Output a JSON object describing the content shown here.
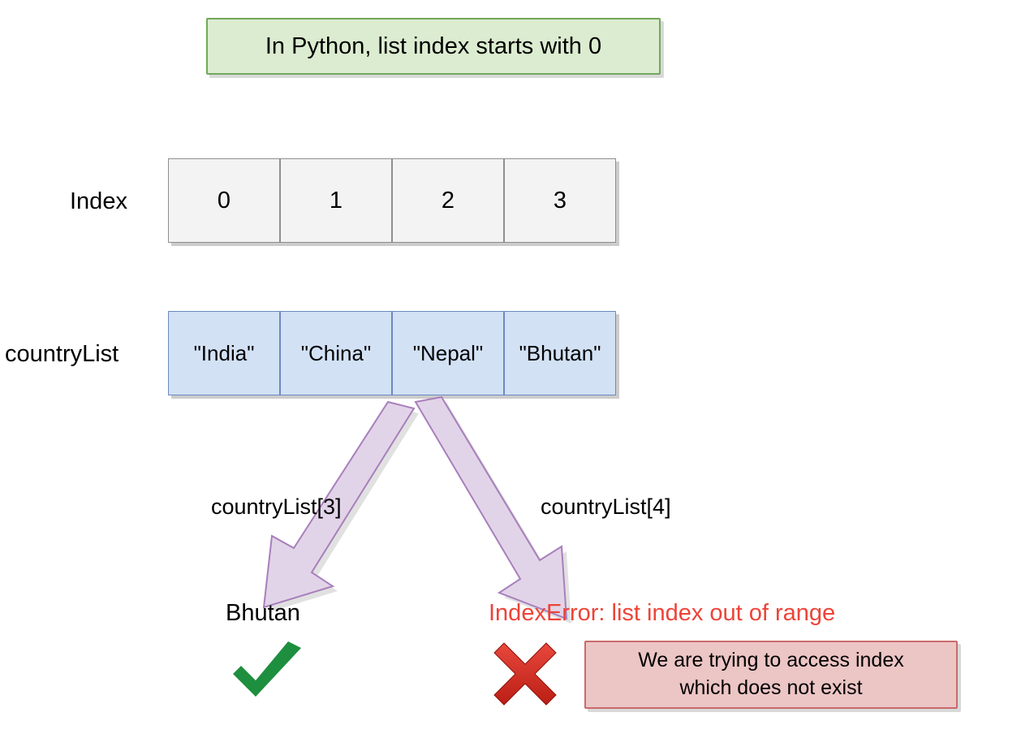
{
  "title": "In Python, list index starts with 0",
  "index_label": "Index",
  "list_label": "countryList",
  "indices": [
    "0",
    "1",
    "2",
    "3"
  ],
  "items": [
    "\"India\"",
    "\"China\"",
    "\"Nepal\"",
    "\"Bhutan\""
  ],
  "left_expr": "countryList[3]",
  "right_expr": "countryList[4]",
  "left_result": "Bhutan",
  "error_text": "IndexError: list index out of range",
  "error_note_line1": "We are trying to access index",
  "error_note_line2": "which does not exist",
  "colors": {
    "title_bg": "#dcecd0",
    "title_border": "#72a85a",
    "index_bg": "#f3f3f3",
    "index_border": "#8e8e8e",
    "list_bg": "#d3e1f5",
    "list_border": "#6a8abf",
    "arrow_fill": "#e2d4e8",
    "arrow_stroke": "#a87fbc",
    "check": "#1d8f3e",
    "cross": "#d42a1f",
    "error_text": "#ed4438",
    "error_box_bg": "#ecc5c5",
    "error_box_border": "#c96a6a"
  }
}
